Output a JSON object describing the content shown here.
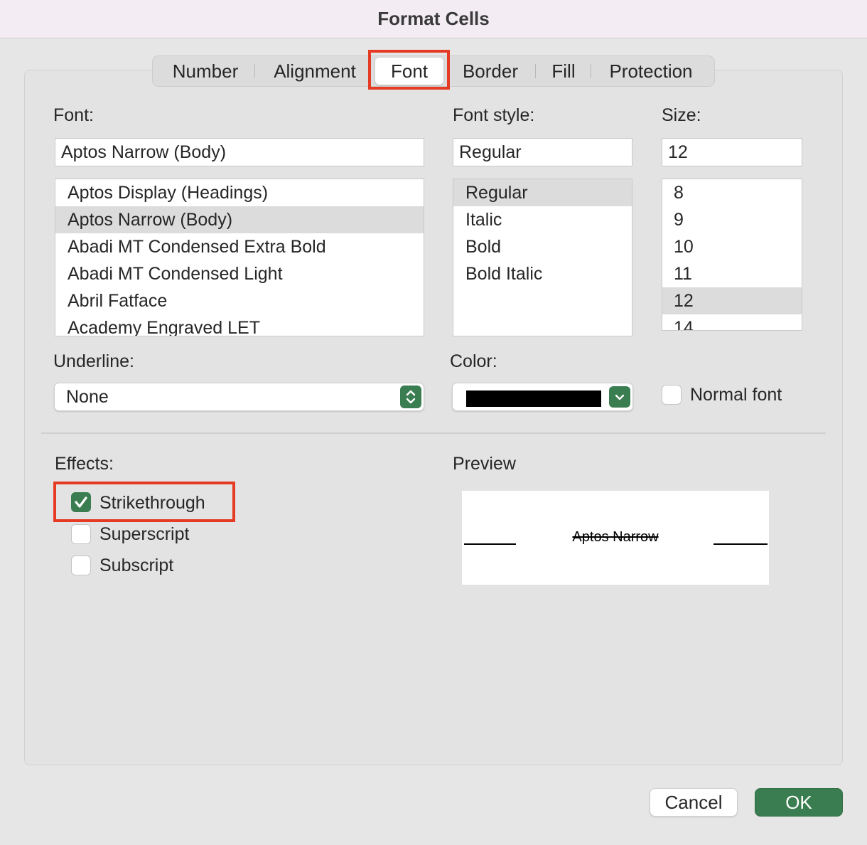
{
  "window": {
    "title": "Format Cells"
  },
  "tabs": [
    {
      "label": "Number"
    },
    {
      "label": "Alignment"
    },
    {
      "label": "Font"
    },
    {
      "label": "Border"
    },
    {
      "label": "Fill"
    },
    {
      "label": "Protection"
    }
  ],
  "active_tab": "Font",
  "font": {
    "label": "Font:",
    "value": "Aptos Narrow (Body)",
    "list": [
      "Aptos Display (Headings)",
      "Aptos Narrow (Body)",
      "Abadi MT Condensed Extra Bold",
      "Abadi MT Condensed Light",
      "Abril Fatface",
      "Academy Engraved LET"
    ],
    "selected_index": 1
  },
  "font_style": {
    "label": "Font style:",
    "value": "Regular",
    "list": [
      "Regular",
      "Italic",
      "Bold",
      "Bold Italic"
    ],
    "selected_index": 0
  },
  "size": {
    "label": "Size:",
    "value": "12",
    "list": [
      "8",
      "9",
      "10",
      "11",
      "12",
      "14"
    ],
    "selected_index": 4
  },
  "underline": {
    "label": "Underline:",
    "value": "None"
  },
  "color": {
    "label": "Color:",
    "swatch": "#000000"
  },
  "normal_font": {
    "label": "Normal font",
    "checked": false
  },
  "effects": {
    "label": "Effects:",
    "strikethrough": {
      "label": "Strikethrough",
      "checked": true
    },
    "superscript": {
      "label": "Superscript",
      "checked": false
    },
    "subscript": {
      "label": "Subscript",
      "checked": false
    }
  },
  "preview": {
    "label": "Preview",
    "sample": "Aptos Narrow"
  },
  "buttons": {
    "cancel": "Cancel",
    "ok": "OK"
  },
  "colors": {
    "accent_green": "#3a7d50",
    "highlight_red": "#e53b24",
    "title_bar": "#f3edf3"
  },
  "icons": {
    "checkmark": "check-icon",
    "popup_arrows": "updown-chevron-icon",
    "dropdown": "chevron-down-icon"
  }
}
